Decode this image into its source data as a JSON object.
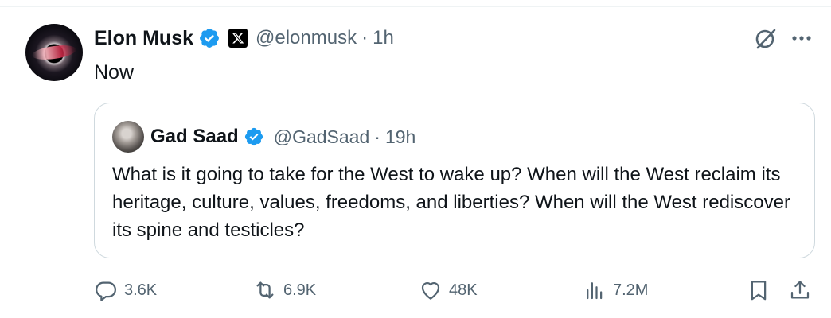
{
  "tweet": {
    "author_name": "Elon Musk",
    "handle": "@elonmusk",
    "separator": "·",
    "time": "1h",
    "text": "Now",
    "icons": {
      "verified": "verified-badge-icon",
      "affiliate": "x-logo-icon",
      "grok": "grok-icon",
      "more": "more-icon"
    }
  },
  "quote": {
    "author_name": "Gad Saad",
    "handle": "@GadSaad",
    "separator": "·",
    "time": "19h",
    "text": "What is it going to take for the West to wake up?  When will the West reclaim its heritage, culture, values, freedoms, and liberties?  When will the West rediscover its spine and testicles?"
  },
  "actions": {
    "replies": "3.6K",
    "reposts": "6.9K",
    "likes": "48K",
    "views": "7.2M"
  },
  "colors": {
    "verified": "#1d9bf0",
    "secondary_text": "#536471",
    "primary_text": "#0f1419",
    "border": "#cfd9de"
  }
}
